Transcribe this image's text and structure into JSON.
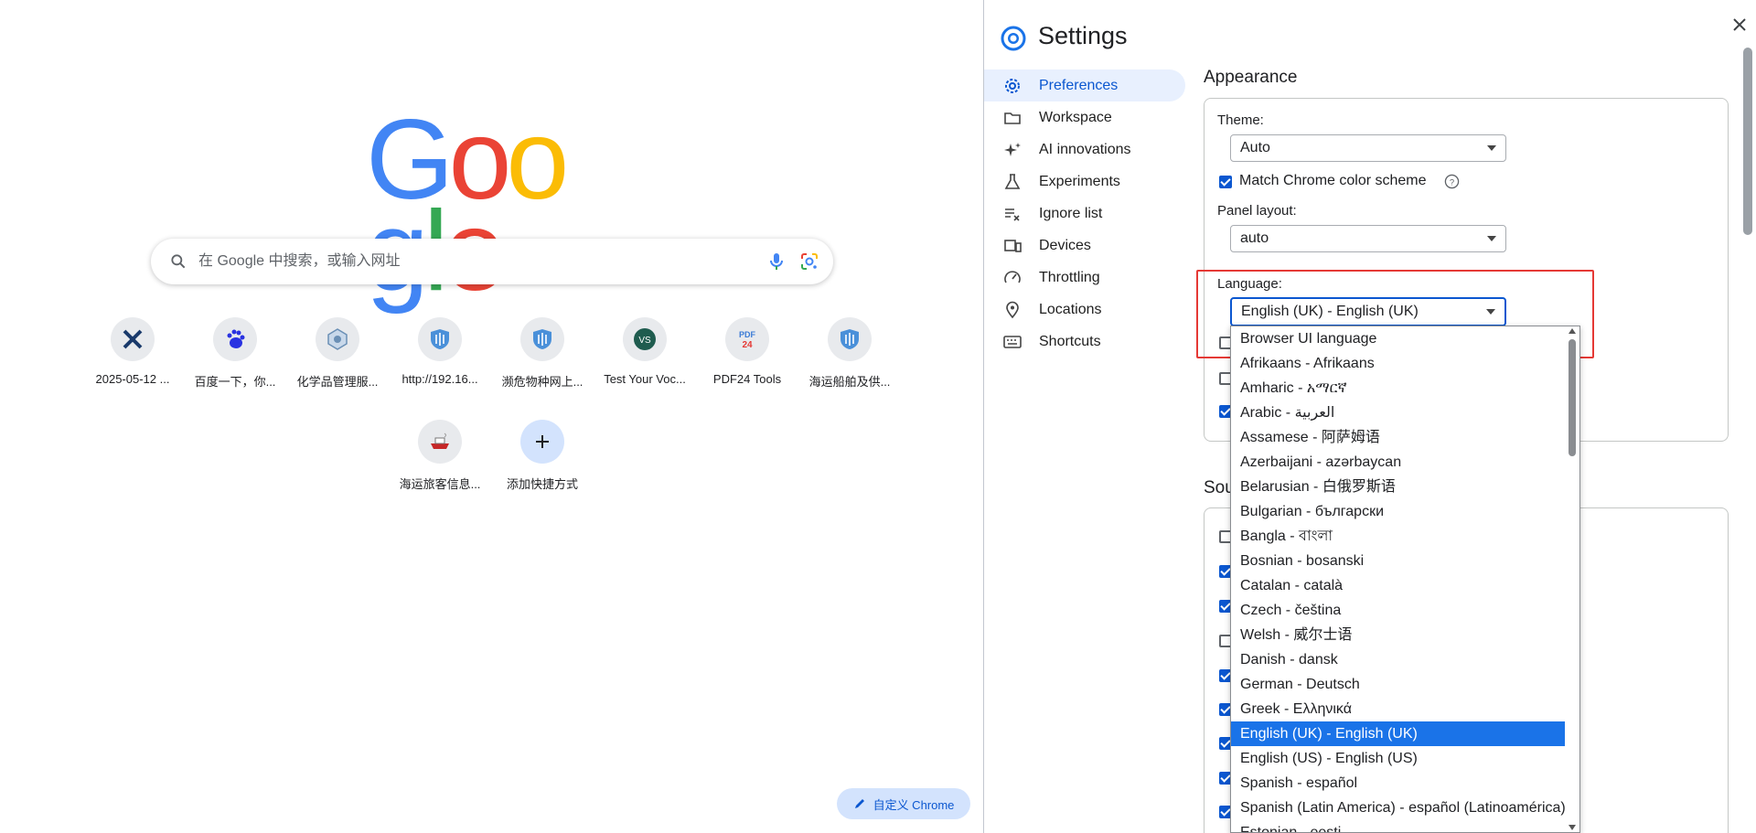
{
  "ntp": {
    "search_placeholder": "在 Google 中搜索，或输入网址",
    "shortcuts": [
      {
        "label": "2025-05-12 ...",
        "icon": "crossed-tools-icon"
      },
      {
        "label": "百度一下，你...",
        "icon": "baidu-paw-icon"
      },
      {
        "label": "化学品管理服...",
        "icon": "hexagon-badge-icon"
      },
      {
        "label": "http://192.16...",
        "icon": "blue-shield-icon"
      },
      {
        "label": "濒危物种网上...",
        "icon": "blue-shield-icon"
      },
      {
        "label": "Test Your Voc...",
        "icon": "vs-globe-icon"
      },
      {
        "label": "PDF24 Tools",
        "icon": "pdf24-icon"
      },
      {
        "label": "海运船舶及供...",
        "icon": "blue-shield-icon"
      },
      {
        "label": "海运旅客信息...",
        "icon": "ship-icon"
      },
      {
        "label": "添加快捷方式",
        "icon": "plus-icon"
      }
    ],
    "customize_label": "自定义 Chrome"
  },
  "settings": {
    "title": "Settings",
    "nav": [
      {
        "label": "Preferences",
        "icon": "gear-icon",
        "active": true
      },
      {
        "label": "Workspace",
        "icon": "folder-icon"
      },
      {
        "label": "AI innovations",
        "icon": "sparkle-icon"
      },
      {
        "label": "Experiments",
        "icon": "flask-icon"
      },
      {
        "label": "Ignore list",
        "icon": "list-x-icon"
      },
      {
        "label": "Devices",
        "icon": "devices-icon"
      },
      {
        "label": "Throttling",
        "icon": "gauge-icon"
      },
      {
        "label": "Locations",
        "icon": "pin-icon"
      },
      {
        "label": "Shortcuts",
        "icon": "keyboard-icon"
      }
    ],
    "appearance": {
      "title": "Appearance",
      "theme_label": "Theme:",
      "theme_value": "Auto",
      "match_color_label": "Match Chrome color scheme",
      "panel_layout_label": "Panel layout:",
      "panel_layout_value": "auto",
      "language_label": "Language:",
      "language_value": "English (UK) - English (UK)"
    },
    "sources_title_partial": "Sou",
    "language_options": [
      "Browser UI language",
      "Afrikaans - Afrikaans",
      "Amharic - አማርኛ",
      "Arabic - العربية",
      "Assamese - 阿萨姆语",
      "Azerbaijani - azərbaycan",
      "Belarusian - 白俄罗斯语",
      "Bulgarian - български",
      "Bangla - বাংলা",
      "Bosnian - bosanski",
      "Catalan - català",
      "Czech - čeština",
      "Welsh - 威尔士语",
      "Danish - dansk",
      "German - Deutsch",
      "Greek - Ελληνικά",
      "English (UK) - English (UK)",
      "English (US) - English (US)",
      "Spanish - español",
      "Spanish (Latin America) - español (Latinoamérica)",
      "Estonian - eesti"
    ],
    "selected_language_index": 16
  },
  "colors": {
    "accent": "#0b57d0",
    "highlight": "#e53935",
    "selected_option": "#1a73e8"
  }
}
